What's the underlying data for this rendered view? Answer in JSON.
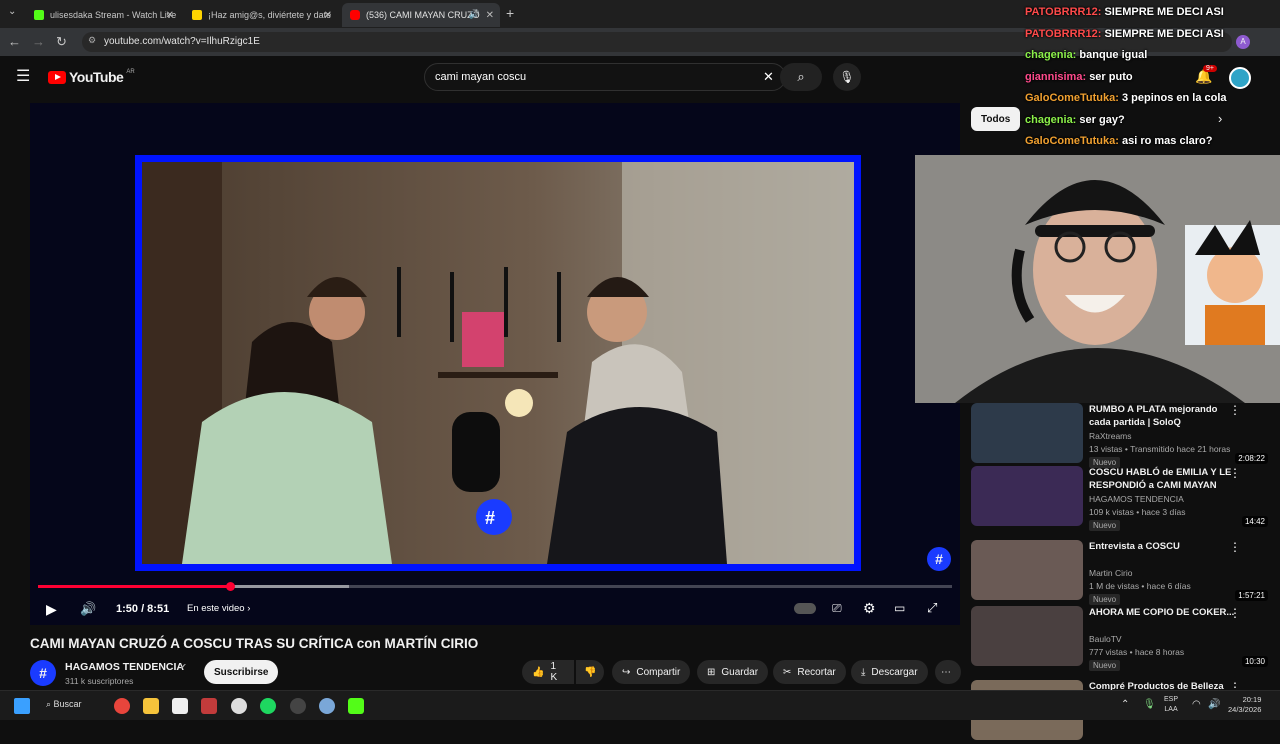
{
  "browser": {
    "tabs": [
      {
        "title": "ulisesdaka Stream - Watch Live",
        "color": "#53fc18"
      },
      {
        "title": "¡Haz amig@s, diviértete y date",
        "color": "#ffd400"
      },
      {
        "title": "(536) CAMI MAYAN CRUZÓ",
        "color": "#ff0000"
      }
    ],
    "new_tab": "+",
    "url": "youtube.com/watch?v=IlhuRzigc1E"
  },
  "youtube": {
    "logo": "YouTube",
    "region": "AR",
    "search_value": "cami mayan coscu",
    "notif_count": "9+",
    "filter_chip": "Todos"
  },
  "player": {
    "time": "1:50 / 8:51",
    "chapter": "En este video",
    "progress": 0.21,
    "buffered": 0.34
  },
  "video": {
    "title": "CAMI MAYAN CRUZÓ A COSCU TRAS SU CRÍTICA con MARTÍN CIRIO",
    "channel": "HAGAMOS TENDENCIA",
    "subs": "311 k suscriptores",
    "subscribe": "Suscribirse",
    "likes": "1 K",
    "share": "Compartir",
    "save": "Guardar",
    "clip": "Recortar",
    "download": "Descargar"
  },
  "chat": [
    {
      "user": "PATOBRRR12:",
      "msg": "SIEMPRE ME DECI ASI",
      "color": "#ff4b4b"
    },
    {
      "user": "PATOBRRR12:",
      "msg": "SIEMPRE ME DECI ASI",
      "color": "#ff4b4b"
    },
    {
      "user": "chagenia:",
      "msg": "banque igual",
      "color": "#8cf04a"
    },
    {
      "user": "giannisima:",
      "msg": "ser puto",
      "color": "#ff4b8c"
    },
    {
      "user": "GaloComeTutuka:",
      "msg": "3 pepinos en la cola",
      "color": "#f0a030"
    },
    {
      "user": "chagenia:",
      "msg": "ser gay?",
      "color": "#8cf04a"
    },
    {
      "user": "GaloComeTutuka:",
      "msg": "asi ro mas claro?",
      "color": "#f0a030"
    }
  ],
  "recommendations": [
    {
      "title": "RUMBO A PLATA mejorando cada partida | SoloQ",
      "channel": "RaXtreams",
      "meta": "13 vistas • Transmitido hace 21 horas",
      "badge": "Nuevo",
      "duration": "2:08:22",
      "thumb": "#2d3a4a"
    },
    {
      "title": "COSCU HABLÓ de EMILIA Y LE RESPONDIÓ a CAMI MAYAN",
      "channel": "HAGAMOS TENDENCIA",
      "meta": "109 k vistas • hace 3 días",
      "badge": "Nuevo",
      "duration": "14:42",
      "thumb": "#3b2a55"
    },
    {
      "title": "Entrevista a COSCU",
      "channel": "Martin Cirio",
      "meta": "1 M de vistas • hace 6 días",
      "badge": "Nuevo",
      "duration": "1:57:21",
      "thumb": "#6a5a55"
    },
    {
      "title": "AHORA ME COPIO DE COKER...",
      "channel": "BauloTV",
      "meta": "777 vistas • hace 8 horas",
      "badge": "Nuevo",
      "duration": "10:30",
      "thumb": "#4a4040"
    },
    {
      "title": "Compré Productos de Belleza",
      "channel": "",
      "meta": "",
      "badge": "",
      "duration": "",
      "thumb": "#7a6a5a"
    }
  ],
  "taskbar": {
    "search": "Buscar",
    "lang": "ESP",
    "lang2": "LAA",
    "time": "20:19",
    "date": "24/3/2026"
  }
}
